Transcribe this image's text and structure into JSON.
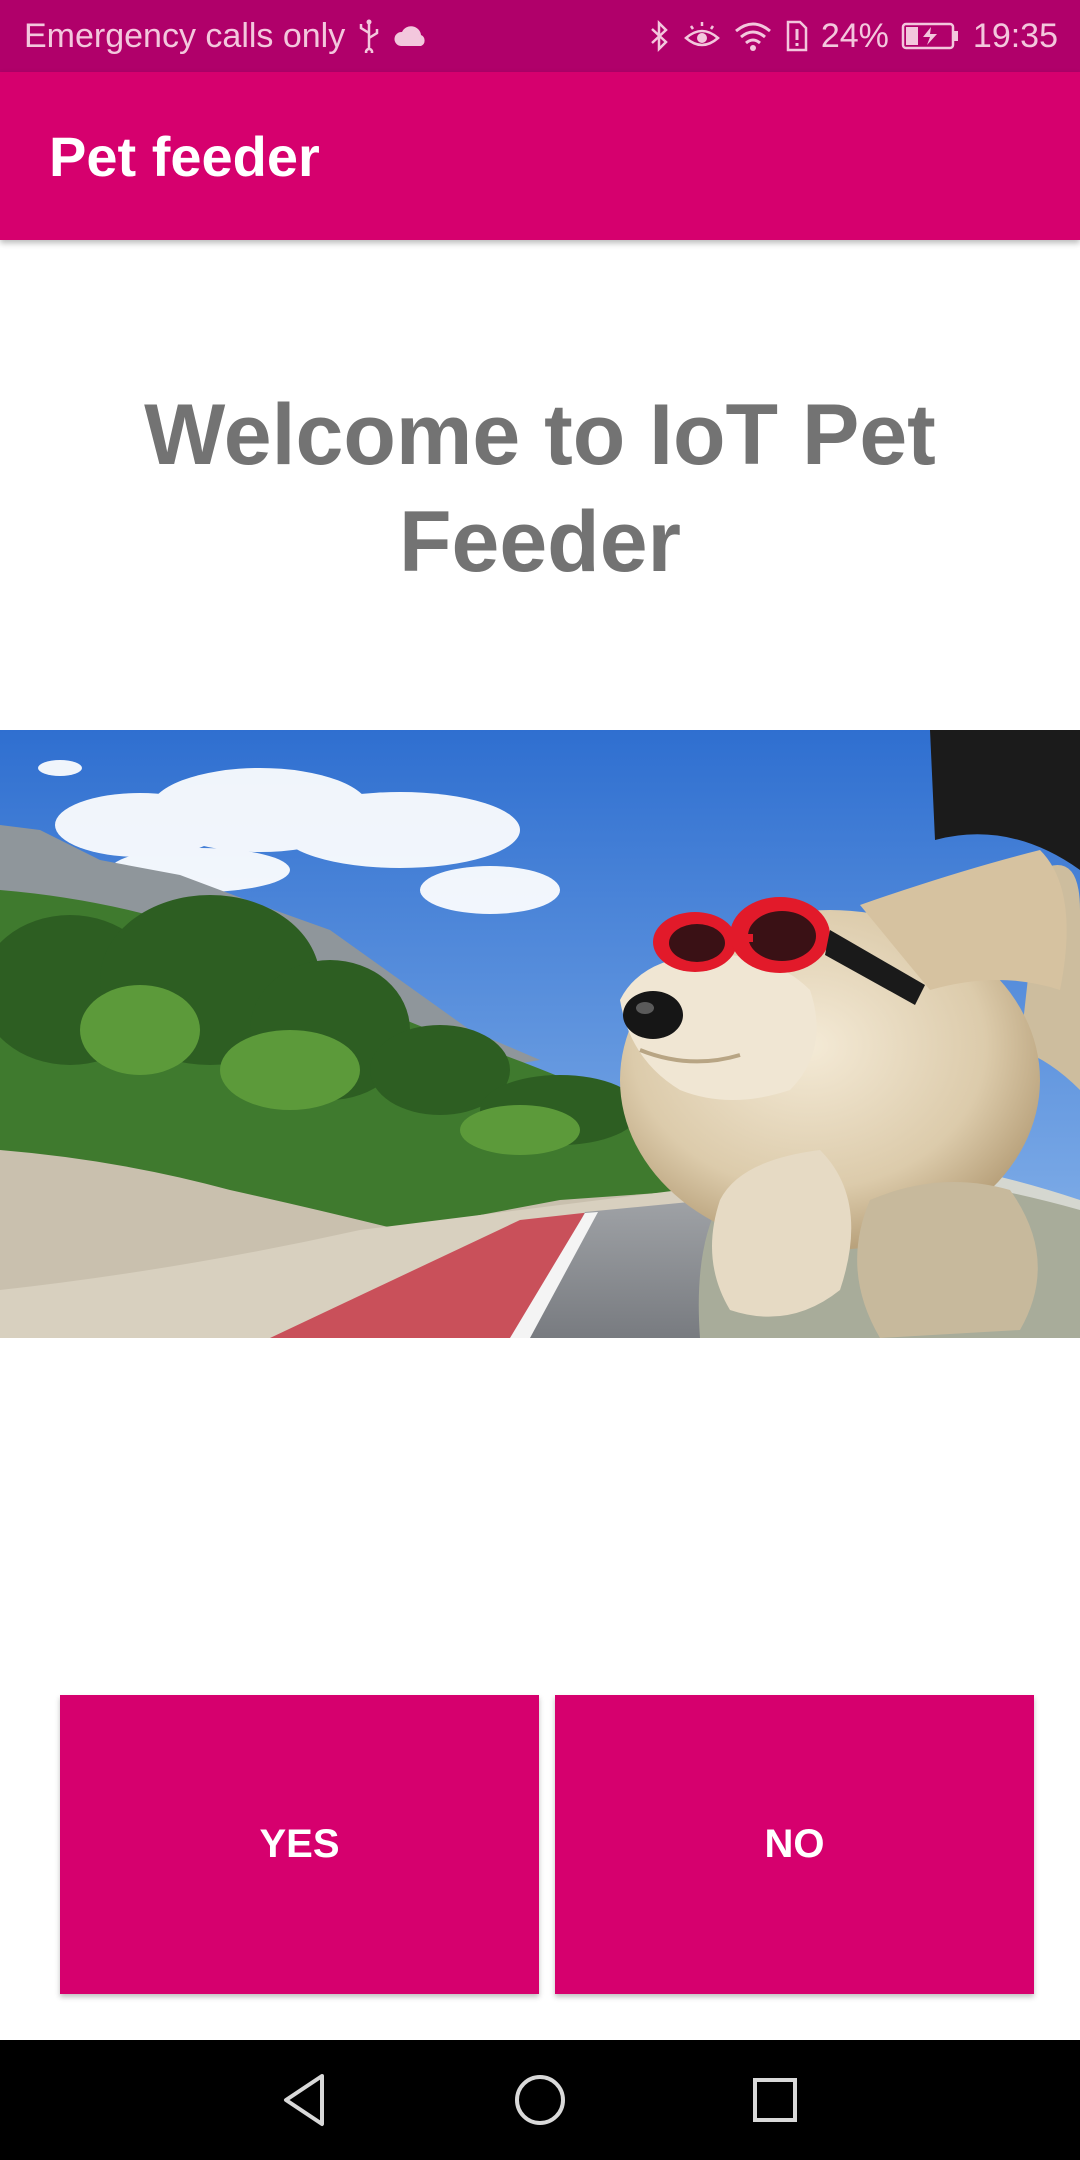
{
  "status_bar": {
    "carrier": "Emergency calls only",
    "battery_percent": "24%",
    "time": "19:35",
    "icons": [
      "usb-icon",
      "cloud-icon",
      "bluetooth-icon",
      "eye-comfort-icon",
      "wifi-icon",
      "sim-icon",
      "battery-charging-icon"
    ]
  },
  "app_bar": {
    "title": "Pet feeder"
  },
  "main": {
    "welcome_title": "Welcome to IoT Pet Feeder",
    "hero_image": "dog-with-red-goggles-in-car-window"
  },
  "buttons": {
    "yes_label": "YES",
    "no_label": "NO"
  },
  "nav_bar": {
    "icons": [
      "back-icon",
      "home-icon",
      "recents-icon"
    ]
  },
  "colors": {
    "accent": "#d6006e",
    "status_bar": "#b0006a",
    "title_text": "#737373"
  }
}
